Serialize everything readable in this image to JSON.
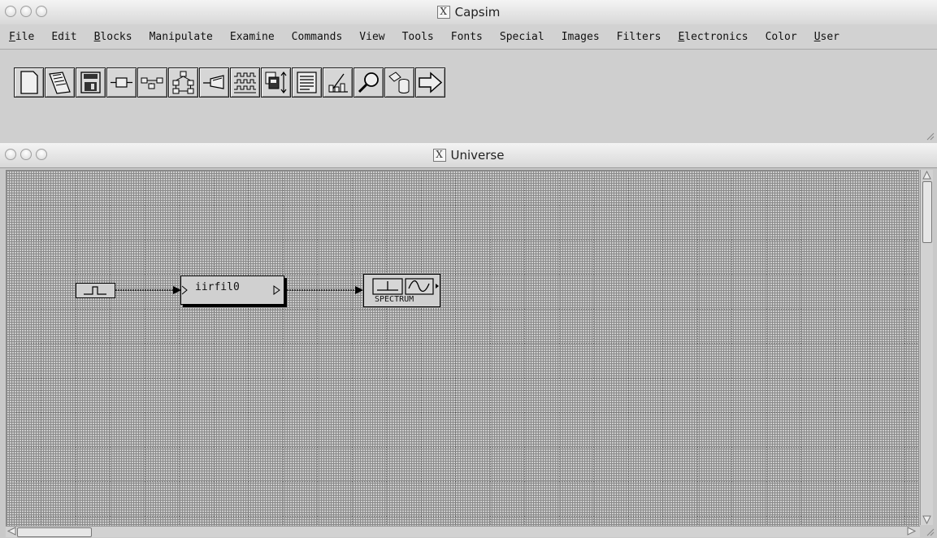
{
  "capsim_window": {
    "title": "Capsim",
    "menu": [
      {
        "label": "File",
        "underline": "F",
        "rest": "ile"
      },
      {
        "label": "Edit",
        "underline": "",
        "rest": "Edit"
      },
      {
        "label": "Blocks",
        "underline": "B",
        "rest": "locks"
      },
      {
        "label": "Manipulate",
        "underline": "",
        "rest": "Manipulate"
      },
      {
        "label": "Examine",
        "underline": "",
        "rest": "Examine"
      },
      {
        "label": "Commands",
        "underline": "",
        "rest": "Commands"
      },
      {
        "label": "View",
        "underline": "",
        "rest": "View"
      },
      {
        "label": "Tools",
        "underline": "",
        "rest": "Tools"
      },
      {
        "label": "Fonts",
        "underline": "",
        "rest": "Fonts"
      },
      {
        "label": "Special",
        "underline": "",
        "rest": "Special"
      },
      {
        "label": "Images",
        "underline": "",
        "rest": "Images"
      },
      {
        "label": "Filters",
        "underline": "",
        "rest": "Filters"
      },
      {
        "label": "Electronics",
        "underline": "E",
        "rest": "lectronics"
      },
      {
        "label": "Color",
        "underline": "",
        "rest": "Color"
      },
      {
        "label": "User",
        "underline": "U",
        "rest": "ser"
      }
    ],
    "toolbar_icons": [
      "new-file-icon",
      "open-file-icon",
      "save-file-icon",
      "block-icon",
      "connect-blocks-icon",
      "hierarchy-icon",
      "probe-icon",
      "waveform-icon",
      "copy-move-icon",
      "list-icon",
      "plot-icon",
      "zoom-icon",
      "database-icon",
      "exit-arrow-icon"
    ]
  },
  "universe_window": {
    "title": "Universe",
    "blocks": {
      "pulse_source": {
        "icon": "pulse-icon"
      },
      "filter": {
        "label": "iirfil0"
      },
      "spectrum": {
        "label": "SPECTRUM"
      }
    }
  }
}
